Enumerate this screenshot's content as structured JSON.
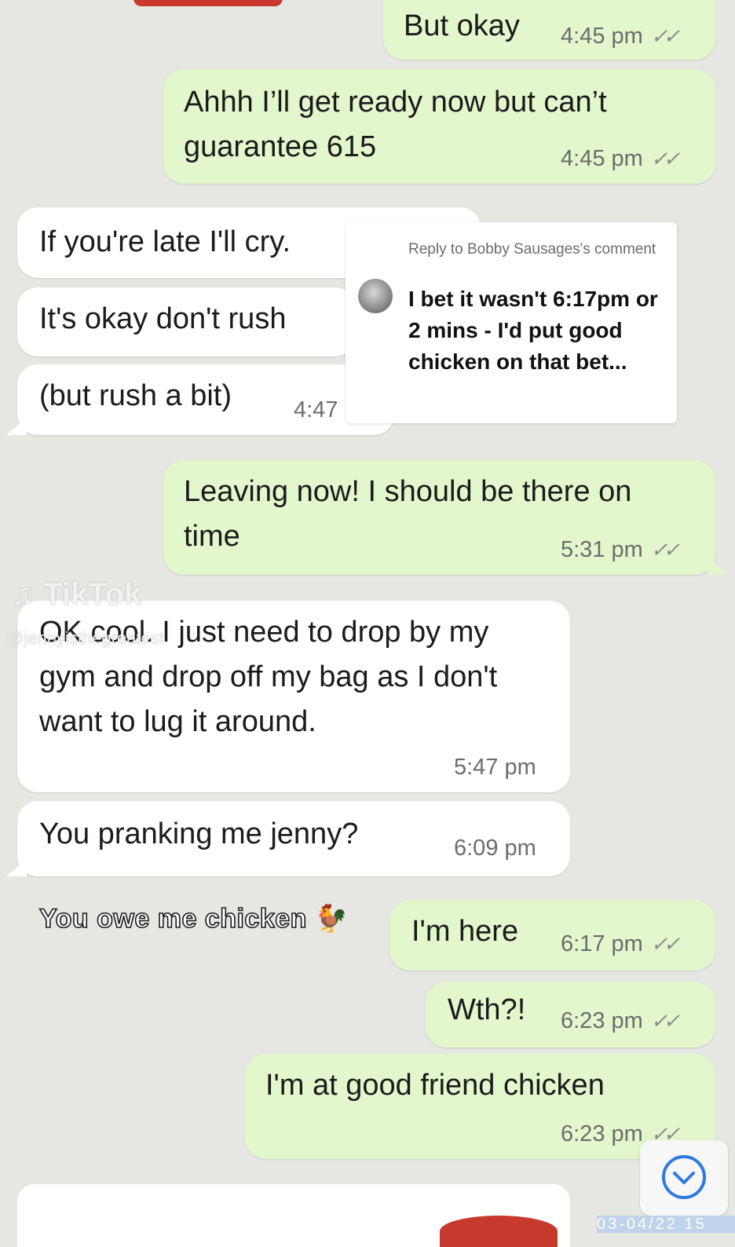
{
  "messages": [
    {
      "text": "But okay",
      "time": "4:45 pm",
      "ticks": "✓✓"
    },
    {
      "text": "Ahhh I’ll get ready now but can’t guarantee 615",
      "time": "4:45 pm",
      "ticks": "✓✓"
    },
    {
      "text": "If you're late I'll cry."
    },
    {
      "text": "It's okay don't rush"
    },
    {
      "text": "(but rush a bit)",
      "time": "4:47"
    },
    {
      "text": "Leaving now! I should be there on time",
      "time": "5:31 pm",
      "ticks": "✓✓"
    },
    {
      "text": "OK cool. I just need to drop by my gym and drop off my bag as I don't want to lug it around.",
      "time": "5:47 pm"
    },
    {
      "text": "You pranking me jenny?",
      "time": "6:09 pm"
    },
    {
      "text": "I'm here",
      "time": "6:17 pm",
      "ticks": "✓✓"
    },
    {
      "text": "Wth?!",
      "time": "6:23 pm",
      "ticks": "✓✓"
    },
    {
      "text": "I'm at good friend chicken",
      "time": "6:23 pm",
      "ticks": "✓✓"
    }
  ],
  "reply_comment": {
    "header": "Reply to Bobby Sausages's comment",
    "body": "I bet it wasn't 6:17pm or 2 mins - I'd put good chicken on that bet..."
  },
  "watermark": {
    "brand": "TikTok",
    "handle": "@jennyisthegreatest"
  },
  "caption": {
    "text": "You owe me chicken",
    "emoji": "🐓"
  },
  "bottom_stamp": "03-04/22 15",
  "icons": {
    "scroll_down": "chevron-down-circle-icon",
    "tiktok_logo": "tiktok-logo-icon",
    "avatar": "avatar"
  }
}
